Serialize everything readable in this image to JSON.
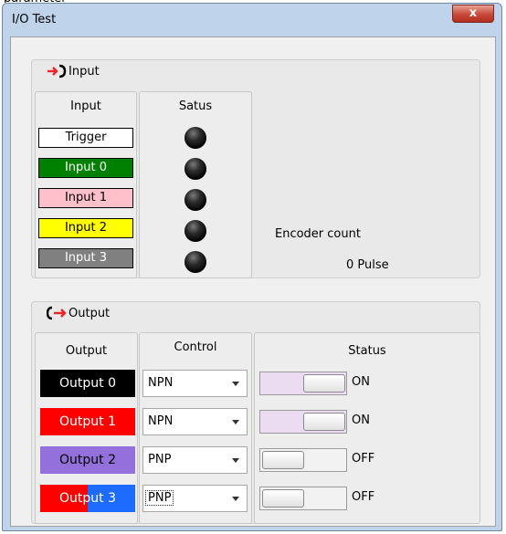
{
  "fragment_text": "parameter",
  "window": {
    "title": "I/O Test",
    "close_glyph": "x"
  },
  "input_group": {
    "title": "Input",
    "icon": "input-arrow-icon",
    "col_input": "Input",
    "col_status": "Satus",
    "items": [
      {
        "label": "Trigger",
        "bg": "#ffffff",
        "fg": "#000000"
      },
      {
        "label": "Input 0",
        "bg": "#008000",
        "fg": "#ffffff"
      },
      {
        "label": "Input 1",
        "bg": "#ffc0cb",
        "fg": "#000000"
      },
      {
        "label": "Input 2",
        "bg": "#ffff00",
        "fg": "#000000"
      },
      {
        "label": "Input 3",
        "bg": "#808080",
        "fg": "#ffffff"
      }
    ],
    "encoder_label": "Encoder count",
    "encoder_value": "0 Pulse"
  },
  "output_group": {
    "title": "Output",
    "icon": "output-arrow-icon",
    "col_output": "Output",
    "col_control": "Control",
    "col_status": "Status",
    "items": [
      {
        "label": "Output 0",
        "bg": "#000000",
        "fg": "#ffffff",
        "control": "NPN",
        "status": "ON"
      },
      {
        "label": "Output 1",
        "bg": "#ff0000",
        "fg": "#ffffff",
        "control": "NPN",
        "status": "ON"
      },
      {
        "label": "Output 2",
        "bg": "#9370db",
        "fg": "#000000",
        "control": "PNP",
        "status": "OFF"
      },
      {
        "label": "Output 3",
        "bg": "#ff0000",
        "bg2": "#1e6bff",
        "fg": "#ffffff",
        "control": "PNP",
        "status": "OFF"
      }
    ]
  },
  "colors": {
    "accent_red": "#e8262a",
    "toggle_on": "#ecdcf2"
  }
}
